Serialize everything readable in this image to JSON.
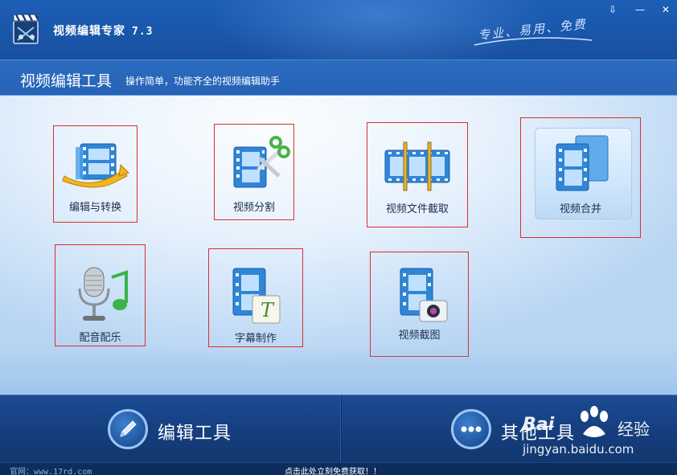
{
  "app": {
    "title": "视频编辑专家",
    "version": "7.3",
    "slogan": "专业、易用、免费"
  },
  "window_controls": {
    "menu": "⇩",
    "minimize": "—",
    "close": "✕"
  },
  "header": {
    "title": "视频编辑工具",
    "subtitle": "操作简单，功能齐全的视频编辑助手"
  },
  "tools": {
    "edit_convert": "编辑与转换",
    "split": "视频分割",
    "cut": "视频文件截取",
    "merge": "视频合并",
    "dubbing": "配音配乐",
    "subtitle": "字幕制作",
    "screenshot": "视频截图"
  },
  "bottom_nav": {
    "edit_tools": "编辑工具",
    "other_tools": "其他工具"
  },
  "status": {
    "site": "官网：www.17rd.com",
    "promo": "点击此处立刻免费获取！！"
  },
  "watermark": {
    "brand_prefix": "Bai",
    "brand_suffix": "经验",
    "url": "jingyan.baidu.com"
  },
  "colors": {
    "titlebar": "#1d5fb6",
    "header_band": "#2b6cc0",
    "selection_border": "#d9302e",
    "bottom_bar": "#163f80",
    "film_blue": "#2f86d6"
  }
}
